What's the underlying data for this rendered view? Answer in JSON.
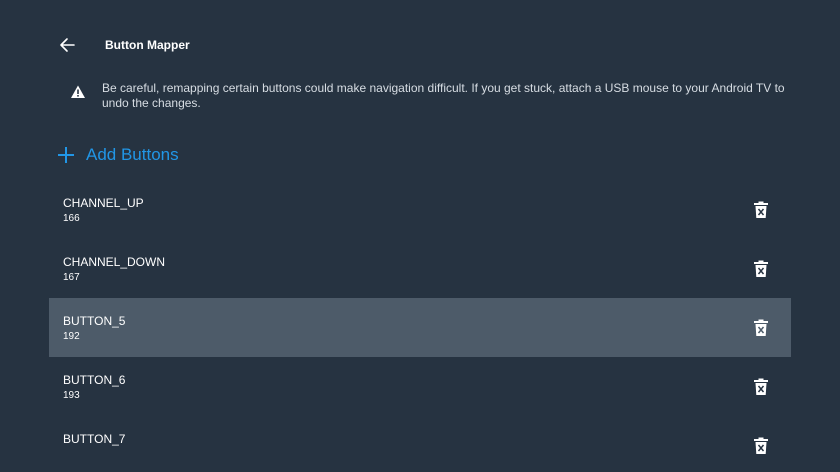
{
  "header": {
    "title": "Button Mapper",
    "back_icon": "arrow-back-icon"
  },
  "warning": {
    "icon": "warning-icon",
    "text": "Be careful, remapping certain buttons could make navigation difficult. If you get stuck, attach a USB mouse to your Android TV to undo the changes."
  },
  "add_buttons": {
    "icon": "plus-icon",
    "label": "Add Buttons"
  },
  "buttons": [
    {
      "name": "CHANNEL_UP",
      "code": "166",
      "selected": false
    },
    {
      "name": "CHANNEL_DOWN",
      "code": "167",
      "selected": false
    },
    {
      "name": "BUTTON_5",
      "code": "192",
      "selected": true
    },
    {
      "name": "BUTTON_6",
      "code": "193",
      "selected": false
    },
    {
      "name": "BUTTON_7",
      "code": "",
      "selected": false
    }
  ],
  "colors": {
    "background": "#263341",
    "accent": "#2196e6",
    "selected_row": "#4d5b69"
  },
  "delete_icon": "delete-icon"
}
